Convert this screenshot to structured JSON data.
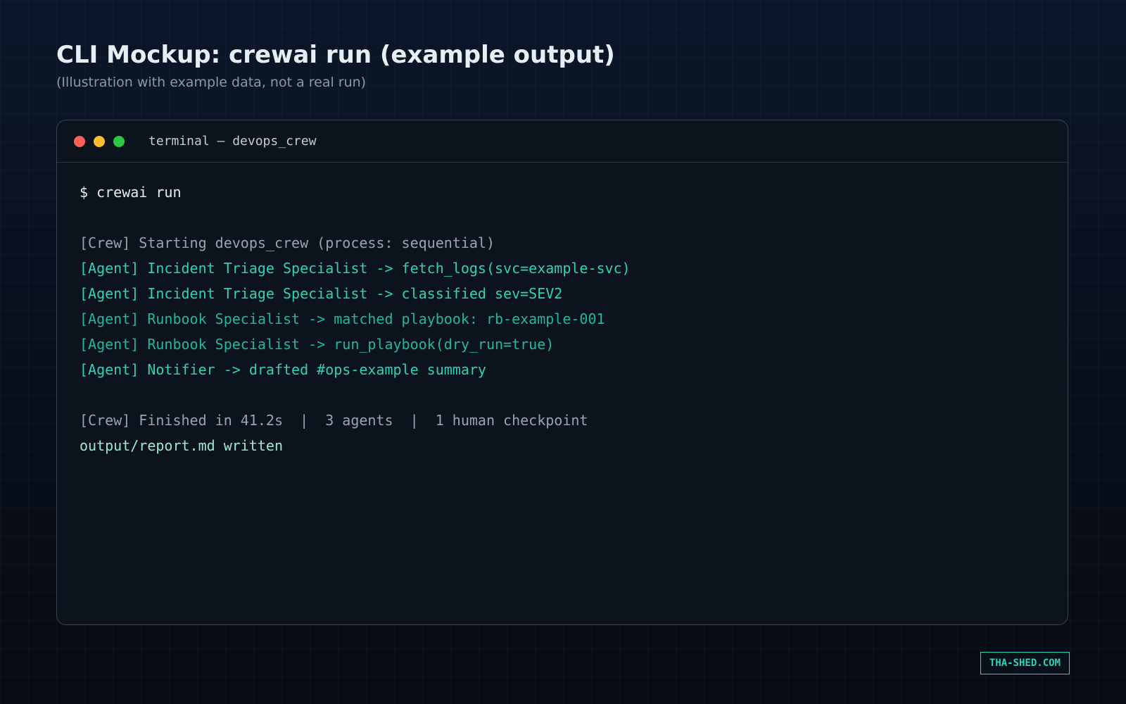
{
  "header": {
    "title": "CLI Mockup: crewai run (example output)",
    "subtitle": "(Illustration with example data, not a real run)"
  },
  "terminal": {
    "window_title": "terminal — devops_crew",
    "traffic_lights": [
      "#ff5f57",
      "#febc2e",
      "#28c840"
    ],
    "lines": {
      "prompt": "$ crewai run",
      "crew_start": "[Crew] Starting devops_crew (process: sequential)",
      "agent_1": "[Agent] Incident Triage Specialist -> fetch_logs(svc=example-svc)",
      "agent_2": "[Agent] Incident Triage Specialist -> classified sev=SEV2",
      "agent_3": "[Agent] Runbook Specialist -> matched playbook: rb-example-001",
      "agent_4": "[Agent] Runbook Specialist -> run_playbook(dry_run=true)",
      "agent_5": "[Agent] Notifier -> drafted #ops-example summary",
      "crew_finish": "[Crew] Finished in 41.2s  |  3 agents  |  1 human checkpoint",
      "output": "output/report.md written"
    }
  },
  "watermark": "THA-SHED.COM",
  "colors": {
    "accent": "#2ed3b7",
    "background": "#0b1220",
    "terminal_bg": "#0d131c"
  }
}
